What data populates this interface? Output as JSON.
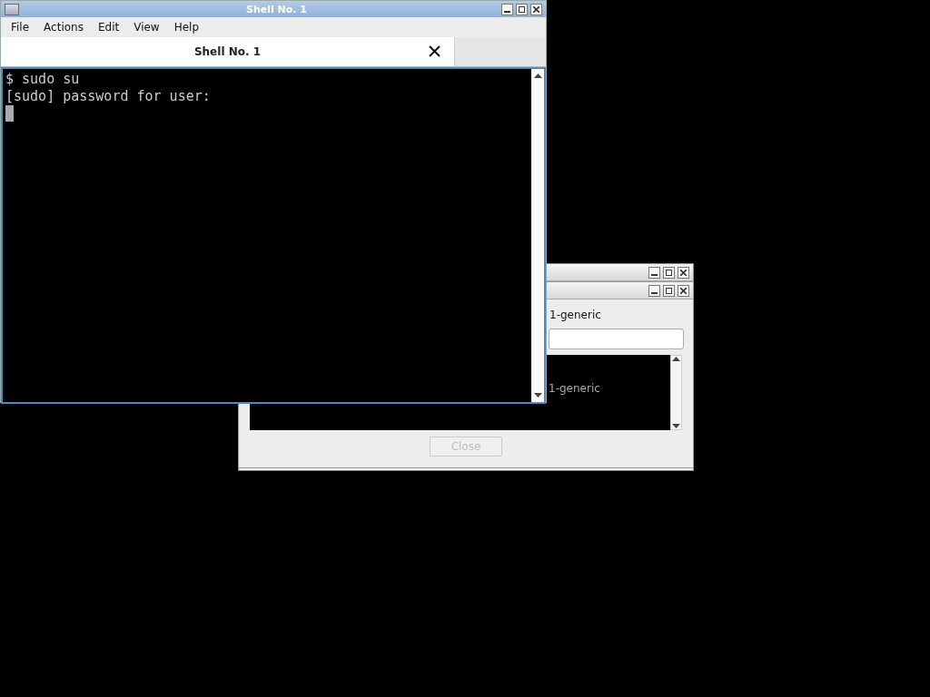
{
  "terminal_window": {
    "title": "Shell No. 1",
    "menu": [
      "File",
      "Actions",
      "Edit",
      "View",
      "Help"
    ],
    "tabs": [
      {
        "label": "Shell No. 1",
        "selected": true
      }
    ],
    "lines": [
      "$ sudo su",
      "[sudo] password for user:"
    ],
    "cursor": true
  },
  "dialog": {
    "label": "1-generic",
    "log": [
      "1-generic"
    ],
    "close_button": {
      "label": "Close",
      "disabled": true
    }
  }
}
